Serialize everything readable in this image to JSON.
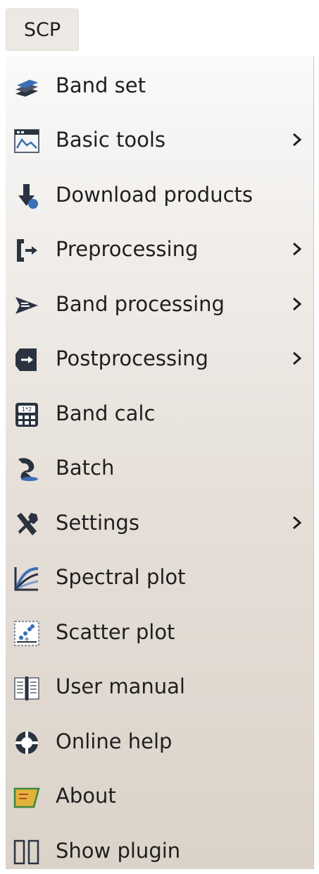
{
  "menubar": {
    "title": "SCP"
  },
  "menu": {
    "items": [
      {
        "label": "Band set",
        "icon": "band-set-icon",
        "submenu": false
      },
      {
        "label": "Basic tools",
        "icon": "basic-tools-icon",
        "submenu": true
      },
      {
        "label": "Download products",
        "icon": "download-products-icon",
        "submenu": false
      },
      {
        "label": "Preprocessing",
        "icon": "preprocessing-icon",
        "submenu": true
      },
      {
        "label": "Band processing",
        "icon": "band-processing-icon",
        "submenu": true
      },
      {
        "label": "Postprocessing",
        "icon": "postprocessing-icon",
        "submenu": true
      },
      {
        "label": "Band calc",
        "icon": "band-calc-icon",
        "submenu": false
      },
      {
        "label": "Batch",
        "icon": "batch-icon",
        "submenu": false
      },
      {
        "label": "Settings",
        "icon": "settings-icon",
        "submenu": true
      },
      {
        "label": "Spectral plot",
        "icon": "spectral-plot-icon",
        "submenu": false
      },
      {
        "label": "Scatter plot",
        "icon": "scatter-plot-icon",
        "submenu": false
      },
      {
        "label": "User manual",
        "icon": "user-manual-icon",
        "submenu": false
      },
      {
        "label": "Online help",
        "icon": "online-help-icon",
        "submenu": false
      },
      {
        "label": "About",
        "icon": "about-icon",
        "submenu": false
      },
      {
        "label": "Show plugin",
        "icon": "show-plugin-icon",
        "submenu": false
      }
    ]
  },
  "colors": {
    "menu_top": "#fafafa",
    "menu_bottom": "#dbd3c9",
    "text": "#1f1f1f",
    "icon_dark": "#2a3340",
    "icon_blue": "#3b6fb6"
  }
}
